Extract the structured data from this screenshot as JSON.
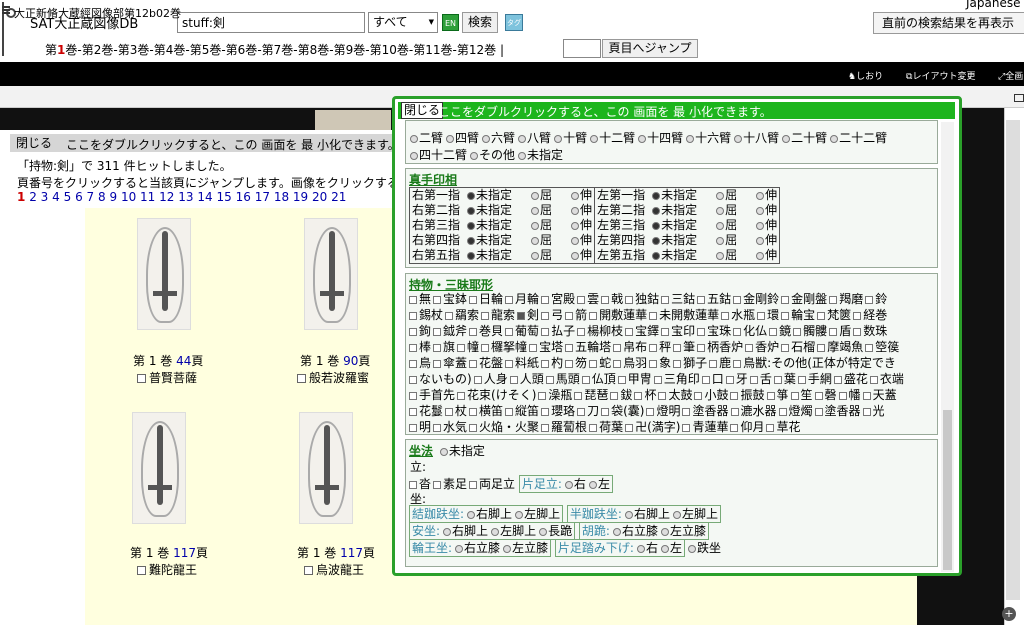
{
  "header": {
    "site_title": "SAT大正蔵図像DB",
    "search_value": "stuff:剣",
    "scope_selected": "すべて",
    "en_toggle": "EN",
    "search_button": "検索",
    "tag_toggle": "タグ",
    "language": "Japanese",
    "recent_button": "直前の検索結果を再表示",
    "volumes": [
      "第1巻",
      "第2巻",
      "第3巻",
      "第4巻",
      "第5巻",
      "第6巻",
      "第7巻",
      "第8巻",
      "第9巻",
      "第10巻",
      "第11巻",
      "第12巻"
    ],
    "current_volume": "第1巻",
    "volume_separator": "-",
    "volume_suffix": " |",
    "page_input": "",
    "jump_button": "頁目へジャンプ"
  },
  "toolbar": {
    "bookmark": "しおり",
    "layout": "レイアウト変更",
    "full": "全画"
  },
  "viewer": {
    "title": "大正新脩大蔵經図像部第12b02巻"
  },
  "left_panel": {
    "close": "閉じる",
    "hint": "ここをダブルクリックすると、この 画面を 最 小化できます。",
    "result_count": "「持物:剣」で 311 件ヒットしました。",
    "result_hint": "頁番号をクリックすると当該頁にジャンプします。画像をクリックすると",
    "pages": [
      "1",
      "2",
      "3",
      "4",
      "5",
      "6",
      "7",
      "8",
      "9",
      "10",
      "11",
      "12",
      "13",
      "14",
      "15",
      "16",
      "17",
      "18",
      "19",
      "20",
      "21"
    ],
    "current_page": "1"
  },
  "results": [
    {
      "caption_pre": "第 1 巻 ",
      "page": "44",
      "caption_post": "頁",
      "name": "普賢菩薩"
    },
    {
      "caption_pre": "第 1 巻 ",
      "page": "90",
      "caption_post": "頁",
      "name": "般若波羅蜜"
    },
    {
      "caption_pre": "第 1 巻 ",
      "page": "117",
      "caption_post": "頁",
      "name": "難陀龍王"
    },
    {
      "caption_pre": "第 1 巻 ",
      "page": "117",
      "caption_post": "頁",
      "name": "烏波龍王"
    }
  ],
  "popup": {
    "close": "閉じる",
    "hint": "ここをダブルクリックすると、この 画面を 最 小化できます。",
    "arms": {
      "row1": [
        "二臂",
        "四臂",
        "六臂",
        "八臂",
        "十臂",
        "十二臂",
        "十四臂",
        "十六臂",
        "十八臂",
        "二十臂",
        "二十二臂"
      ],
      "row2": [
        "四十二臂",
        "その他",
        "未指定"
      ]
    },
    "mudra": {
      "title": "真手印相",
      "right": [
        "右第一指",
        "右第二指",
        "右第三指",
        "右第四指",
        "右第五指"
      ],
      "left": [
        "左第一指",
        "左第二指",
        "左第三指",
        "左第四指",
        "左第五指"
      ],
      "options": [
        "未指定",
        "屈",
        "伸"
      ]
    },
    "attributes": {
      "title": "持物・三昧耶形",
      "lines": [
        [
          "無",
          "宝鉢",
          "日輪",
          "月輪",
          "宮殿",
          "雲",
          "戟",
          "独鈷",
          "三鈷",
          "五鈷",
          "金剛鈴",
          "金剛盤",
          "羯磨",
          "鈴"
        ],
        [
          "錫杖",
          "羂索",
          "龍索",
          "剣",
          "弓",
          "箭",
          "開敷蓮華",
          "未開敷蓮華",
          "水瓶",
          "環",
          "輪宝",
          "梵篋",
          "経巻"
        ],
        [
          "鉤",
          "鉞斧",
          "巻貝",
          "葡萄",
          "払子",
          "楊柳枝",
          "宝鐸",
          "宝印",
          "宝珠",
          "化仏",
          "鏡",
          "髑髏",
          "盾",
          "数珠"
        ],
        [
          "棒",
          "旗",
          "幢",
          "欏拏幢",
          "宝塔",
          "五輪塔",
          "帛布",
          "秤",
          "筆",
          "柄香炉",
          "香炉",
          "石榴",
          "摩竭魚",
          "箜篌"
        ],
        [
          "鳥",
          "傘蓋",
          "花盤",
          "料紙",
          "杓",
          "笏",
          "蛇",
          "鳥羽",
          "象",
          "獅子",
          "鹿",
          "鳥獣:その他(正体が特定でき"
        ],
        [
          "ないもの)",
          "人身",
          "人頭",
          "馬頭",
          "仏頂",
          "甲冑",
          "三角印",
          "口",
          "牙",
          "舌",
          "葉",
          "手網",
          "盛花",
          "衣端"
        ],
        [
          "手首先",
          "花束(けそく)",
          "澡瓶",
          "琵琶",
          "鈸",
          "杯",
          "太鼓",
          "小鼓",
          "振鼓",
          "箏",
          "笙",
          "磬",
          "幡",
          "天蓋"
        ],
        [
          "花鬘",
          "杖",
          "横笛",
          "縦笛",
          "瓔珞",
          "刀",
          "袋(囊)",
          "燈明",
          "塗香器",
          "漉水器",
          "燈燭",
          "塗香器",
          "光"
        ],
        [
          "明",
          "水気",
          "火焔・火聚",
          "羅蔔根",
          "荷葉",
          "卍(満字)",
          "青蓮華",
          "仰月",
          "草花"
        ]
      ],
      "checked": "剣"
    },
    "posture": {
      "title": "坐法",
      "unspecified": "未指定",
      "standing_label": "立:",
      "standing": [
        "沓",
        "素足",
        "両足立"
      ],
      "one_leg_label": "片足立:",
      "one_leg": [
        "右",
        "左"
      ],
      "sitting_label": "坐:",
      "kekka_label": "結跏趺坐:",
      "kekka": [
        "右脚上",
        "左脚上"
      ],
      "hanka_label": "半跏趺坐:",
      "hanka": [
        "右脚上",
        "左脚上"
      ],
      "anza_label": "安坐:",
      "anza": [
        "右脚上",
        "左脚上",
        "長跪"
      ],
      "koki_label": "胡跪:",
      "koki": [
        "右立膝",
        "左立膝"
      ],
      "rinno_label": "輪王坐:",
      "rinno": [
        "右立膝",
        "左立膝"
      ],
      "fumisage_label": "片足踏み下げ:",
      "fumisage": [
        "右",
        "左"
      ],
      "other": "跌坐"
    }
  }
}
